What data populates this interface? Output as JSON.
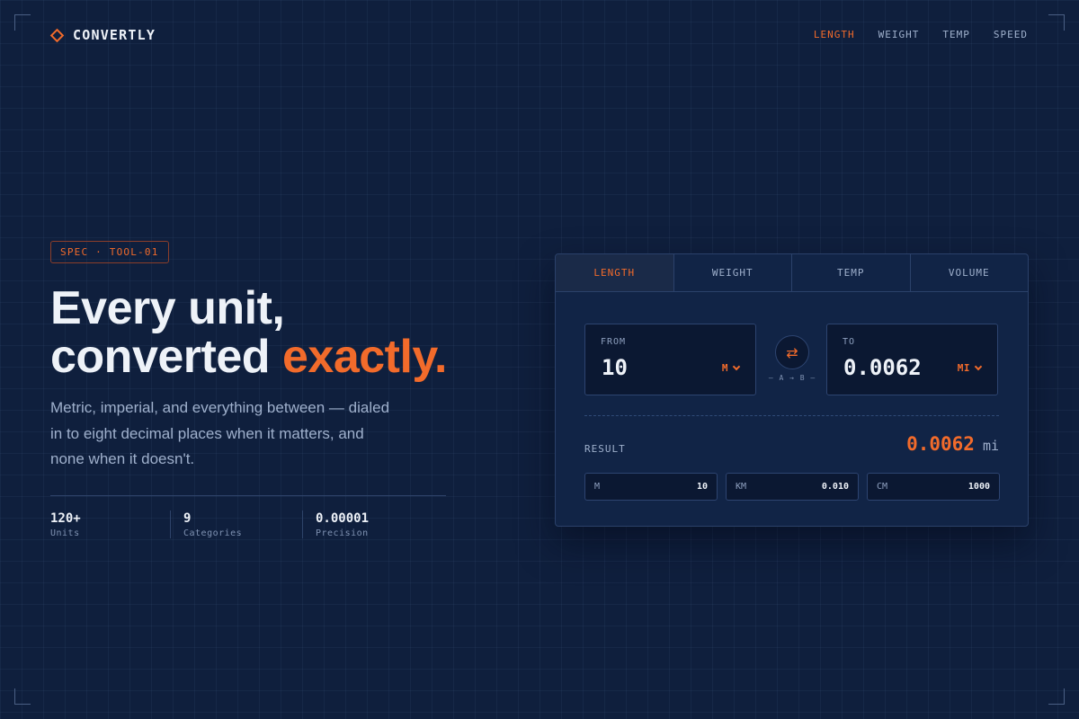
{
  "header": {
    "brand": "CONVERTLY",
    "nav": [
      {
        "label": "LENGTH",
        "active": true
      },
      {
        "label": "WEIGHT",
        "active": false
      },
      {
        "label": "TEMP",
        "active": false
      },
      {
        "label": "SPEED",
        "active": false
      }
    ]
  },
  "hero": {
    "badge": "SPEC · TOOL-01",
    "headline_line1": "Every unit,",
    "headline_line2_prefix": "converted ",
    "headline_line2_accent": "exactly.",
    "lede": "Metric, imperial, and everything between — dialed in to eight decimal places when it matters, and none when it doesn't.",
    "stats": [
      {
        "value": "120+",
        "label": "Units"
      },
      {
        "value": "9",
        "label": "Categories"
      },
      {
        "value": "0.00001",
        "label": "Precision"
      }
    ]
  },
  "converter": {
    "tabs": [
      {
        "label": "LENGTH",
        "active": true
      },
      {
        "label": "WEIGHT",
        "active": false
      },
      {
        "label": "TEMP",
        "active": false
      },
      {
        "label": "VOLUME",
        "active": false
      }
    ],
    "from": {
      "label": "FROM",
      "value": "10",
      "unit": "M"
    },
    "to": {
      "label": "TO",
      "value": "0.0062",
      "unit": "MI"
    },
    "swap_icon": "⇄",
    "swap_caption": "— A → B —",
    "result_label": "RESULT",
    "result_value": "0.0062",
    "result_unit": "mi",
    "equivalents": [
      {
        "unit": "M",
        "value": "10"
      },
      {
        "unit": "KM",
        "value": "0.010"
      },
      {
        "unit": "CM",
        "value": "1000"
      }
    ]
  },
  "colors": {
    "background": "#0f1f3d",
    "accent": "#f26b2b",
    "card": "#112446",
    "text": "#eef2f8",
    "muted": "#9fb0cc"
  }
}
